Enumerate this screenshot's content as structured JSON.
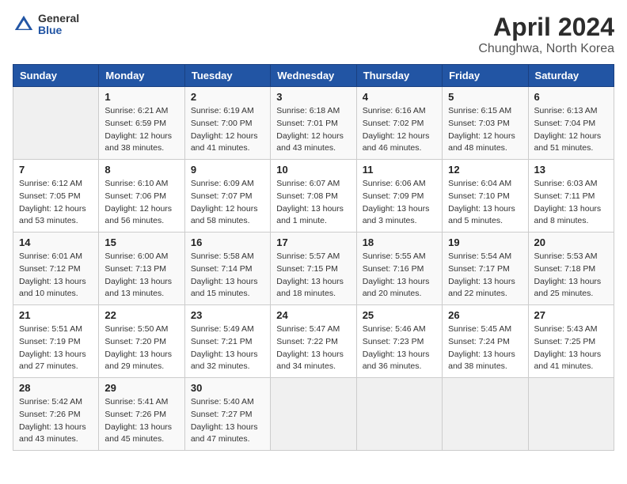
{
  "header": {
    "logo_general": "General",
    "logo_blue": "Blue",
    "month_title": "April 2024",
    "location": "Chunghwa, North Korea"
  },
  "days_of_week": [
    "Sunday",
    "Monday",
    "Tuesday",
    "Wednesday",
    "Thursday",
    "Friday",
    "Saturday"
  ],
  "weeks": [
    [
      {
        "day": "",
        "info": ""
      },
      {
        "day": "1",
        "info": "Sunrise: 6:21 AM\nSunset: 6:59 PM\nDaylight: 12 hours\nand 38 minutes."
      },
      {
        "day": "2",
        "info": "Sunrise: 6:19 AM\nSunset: 7:00 PM\nDaylight: 12 hours\nand 41 minutes."
      },
      {
        "day": "3",
        "info": "Sunrise: 6:18 AM\nSunset: 7:01 PM\nDaylight: 12 hours\nand 43 minutes."
      },
      {
        "day": "4",
        "info": "Sunrise: 6:16 AM\nSunset: 7:02 PM\nDaylight: 12 hours\nand 46 minutes."
      },
      {
        "day": "5",
        "info": "Sunrise: 6:15 AM\nSunset: 7:03 PM\nDaylight: 12 hours\nand 48 minutes."
      },
      {
        "day": "6",
        "info": "Sunrise: 6:13 AM\nSunset: 7:04 PM\nDaylight: 12 hours\nand 51 minutes."
      }
    ],
    [
      {
        "day": "7",
        "info": "Sunrise: 6:12 AM\nSunset: 7:05 PM\nDaylight: 12 hours\nand 53 minutes."
      },
      {
        "day": "8",
        "info": "Sunrise: 6:10 AM\nSunset: 7:06 PM\nDaylight: 12 hours\nand 56 minutes."
      },
      {
        "day": "9",
        "info": "Sunrise: 6:09 AM\nSunset: 7:07 PM\nDaylight: 12 hours\nand 58 minutes."
      },
      {
        "day": "10",
        "info": "Sunrise: 6:07 AM\nSunset: 7:08 PM\nDaylight: 13 hours\nand 1 minute."
      },
      {
        "day": "11",
        "info": "Sunrise: 6:06 AM\nSunset: 7:09 PM\nDaylight: 13 hours\nand 3 minutes."
      },
      {
        "day": "12",
        "info": "Sunrise: 6:04 AM\nSunset: 7:10 PM\nDaylight: 13 hours\nand 5 minutes."
      },
      {
        "day": "13",
        "info": "Sunrise: 6:03 AM\nSunset: 7:11 PM\nDaylight: 13 hours\nand 8 minutes."
      }
    ],
    [
      {
        "day": "14",
        "info": "Sunrise: 6:01 AM\nSunset: 7:12 PM\nDaylight: 13 hours\nand 10 minutes."
      },
      {
        "day": "15",
        "info": "Sunrise: 6:00 AM\nSunset: 7:13 PM\nDaylight: 13 hours\nand 13 minutes."
      },
      {
        "day": "16",
        "info": "Sunrise: 5:58 AM\nSunset: 7:14 PM\nDaylight: 13 hours\nand 15 minutes."
      },
      {
        "day": "17",
        "info": "Sunrise: 5:57 AM\nSunset: 7:15 PM\nDaylight: 13 hours\nand 18 minutes."
      },
      {
        "day": "18",
        "info": "Sunrise: 5:55 AM\nSunset: 7:16 PM\nDaylight: 13 hours\nand 20 minutes."
      },
      {
        "day": "19",
        "info": "Sunrise: 5:54 AM\nSunset: 7:17 PM\nDaylight: 13 hours\nand 22 minutes."
      },
      {
        "day": "20",
        "info": "Sunrise: 5:53 AM\nSunset: 7:18 PM\nDaylight: 13 hours\nand 25 minutes."
      }
    ],
    [
      {
        "day": "21",
        "info": "Sunrise: 5:51 AM\nSunset: 7:19 PM\nDaylight: 13 hours\nand 27 minutes."
      },
      {
        "day": "22",
        "info": "Sunrise: 5:50 AM\nSunset: 7:20 PM\nDaylight: 13 hours\nand 29 minutes."
      },
      {
        "day": "23",
        "info": "Sunrise: 5:49 AM\nSunset: 7:21 PM\nDaylight: 13 hours\nand 32 minutes."
      },
      {
        "day": "24",
        "info": "Sunrise: 5:47 AM\nSunset: 7:22 PM\nDaylight: 13 hours\nand 34 minutes."
      },
      {
        "day": "25",
        "info": "Sunrise: 5:46 AM\nSunset: 7:23 PM\nDaylight: 13 hours\nand 36 minutes."
      },
      {
        "day": "26",
        "info": "Sunrise: 5:45 AM\nSunset: 7:24 PM\nDaylight: 13 hours\nand 38 minutes."
      },
      {
        "day": "27",
        "info": "Sunrise: 5:43 AM\nSunset: 7:25 PM\nDaylight: 13 hours\nand 41 minutes."
      }
    ],
    [
      {
        "day": "28",
        "info": "Sunrise: 5:42 AM\nSunset: 7:26 PM\nDaylight: 13 hours\nand 43 minutes."
      },
      {
        "day": "29",
        "info": "Sunrise: 5:41 AM\nSunset: 7:26 PM\nDaylight: 13 hours\nand 45 minutes."
      },
      {
        "day": "30",
        "info": "Sunrise: 5:40 AM\nSunset: 7:27 PM\nDaylight: 13 hours\nand 47 minutes."
      },
      {
        "day": "",
        "info": ""
      },
      {
        "day": "",
        "info": ""
      },
      {
        "day": "",
        "info": ""
      },
      {
        "day": "",
        "info": ""
      }
    ]
  ]
}
